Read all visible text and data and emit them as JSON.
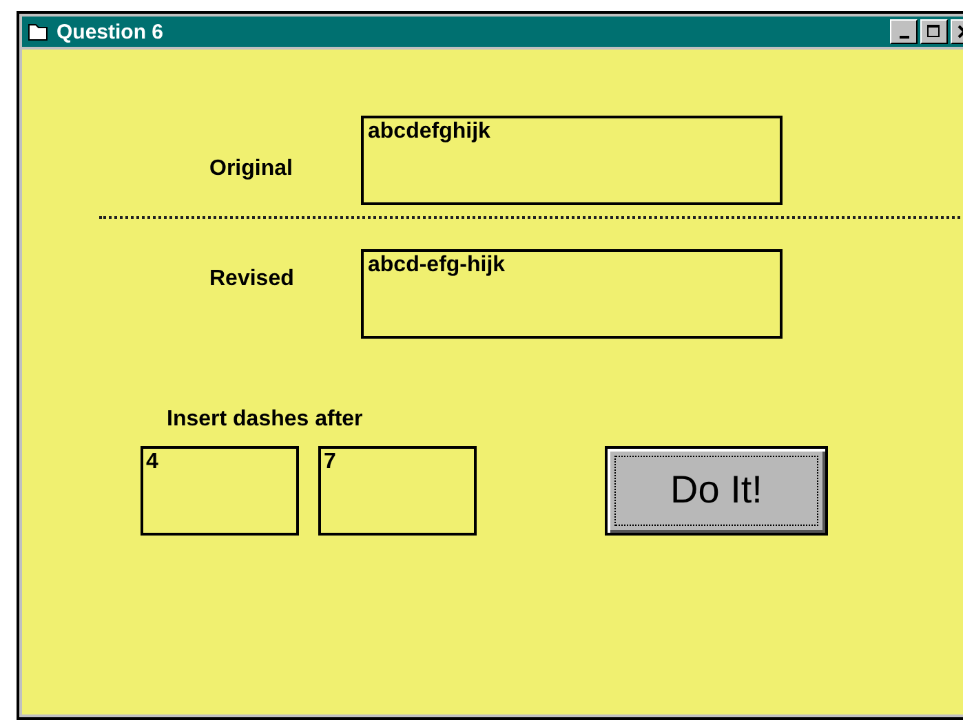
{
  "window": {
    "title": "Question 6"
  },
  "fields": [
    {
      "label": "Original",
      "value": "abcdefghijk"
    },
    {
      "label": "Revised",
      "value": "abcd-efg-hijk"
    }
  ],
  "dashes": {
    "label": "Insert dashes after",
    "values": [
      "4",
      "7"
    ]
  },
  "button": {
    "label": "Do It!"
  }
}
